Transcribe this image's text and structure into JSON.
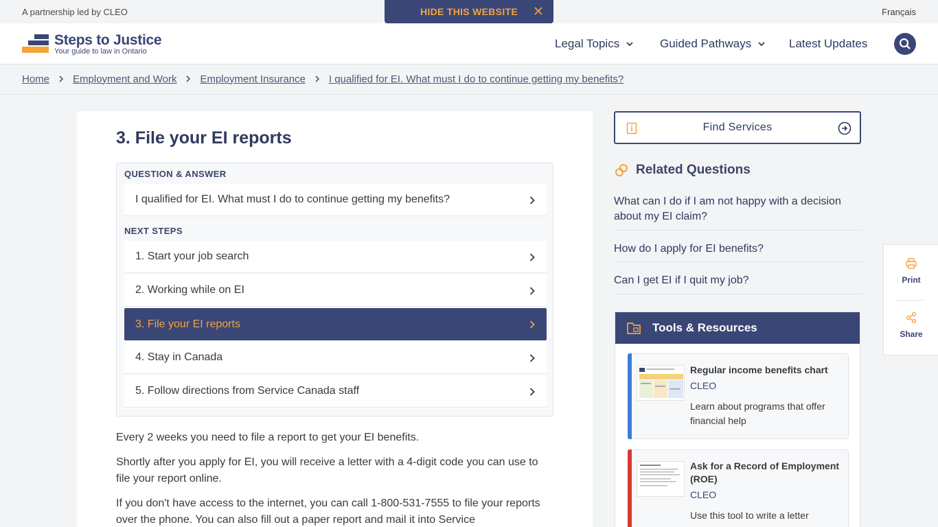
{
  "topbar": {
    "partner_text": "A partnership led by CLEO",
    "hide_label": "HIDE THIS WEBSITE",
    "language": "Français"
  },
  "header": {
    "logo_name": "Steps to Justice",
    "logo_tagline": "Your guide to law in Ontario",
    "nav": {
      "legal_topics": "Legal Topics",
      "guided_pathways": "Guided Pathways",
      "latest_updates": "Latest Updates"
    }
  },
  "breadcrumb": [
    "Home",
    "Employment and Work",
    "Employment Insurance",
    "I qualified for EI. What must I do to continue getting my benefits?"
  ],
  "main": {
    "heading": "3. File your EI reports",
    "qa_label": "QUESTION & ANSWER",
    "qa_question": "I qualified for EI. What must I do to continue getting my benefits?",
    "next_steps_label": "NEXT STEPS",
    "steps": [
      "1. Start your job search",
      "2. Working while on EI",
      "3. File your EI reports",
      "4. Stay in Canada",
      "5. Follow directions from Service Canada staff"
    ],
    "active_step": 2,
    "paragraphs": [
      "Every 2 weeks you need to file a report to get your EI benefits.",
      "Shortly after you apply for EI, you will receive a letter with a 4-digit code you can use to file your report online.",
      "If you don't have access to the internet, you can call 1-800-531-7555 to file your reports over the phone. You can also fill out a paper report and mail it into Service"
    ]
  },
  "sidebar": {
    "find_services": "Find Services",
    "related_heading": "Related Questions",
    "related": [
      "What can I do if I am not happy with a decision about my EI claim?",
      "How do I apply for EI benefits?",
      "Can I get EI if I quit my job?"
    ],
    "tools_heading": "Tools & Resources",
    "resources": [
      {
        "title": "Regular income benefits chart",
        "org": "CLEO",
        "desc": "Learn about programs that offer financial help",
        "color": "#3b7dd8"
      },
      {
        "title": "Ask for a Record of Employment (ROE)",
        "org": "CLEO",
        "desc": "Use this tool to write a letter",
        "color": "#d63a2f"
      }
    ]
  },
  "floating": {
    "print": "Print",
    "share": "Share"
  },
  "colors": {
    "brand_navy": "#3a4676",
    "brand_orange": "#f5a33a"
  }
}
